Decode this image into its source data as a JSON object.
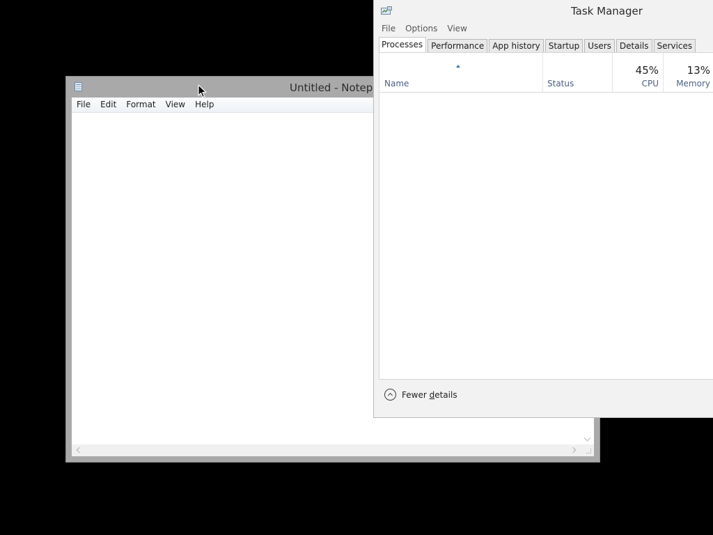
{
  "notepad": {
    "title": "Untitled - Notepad",
    "icon": "notepad-icon",
    "menu": [
      "File",
      "Edit",
      "Format",
      "View",
      "Help"
    ],
    "content": ""
  },
  "taskmanager": {
    "title": "Task Manager",
    "icon": "task-manager-icon",
    "menu": [
      "File",
      "Options",
      "View"
    ],
    "tabs": [
      "Processes",
      "Performance",
      "App history",
      "Startup",
      "Users",
      "Details",
      "Services"
    ],
    "active_tab": "Processes",
    "columns": {
      "name": "Name",
      "status": "Status",
      "cpu_label": "CPU",
      "cpu_value": "45%",
      "memory_label": "Memory",
      "memory_value": "13%"
    },
    "footer": {
      "fewer_details_prefix": "Fewer ",
      "fewer_details_underlined": "d",
      "fewer_details_suffix": "etails"
    }
  },
  "colors": {
    "desktop": "#000000",
    "notepad_frame": "#a9a9a9",
    "taskmanager_bg": "#f2f2f2",
    "column_label": "#4d6082",
    "sort_arrow": "#3a77a8"
  }
}
